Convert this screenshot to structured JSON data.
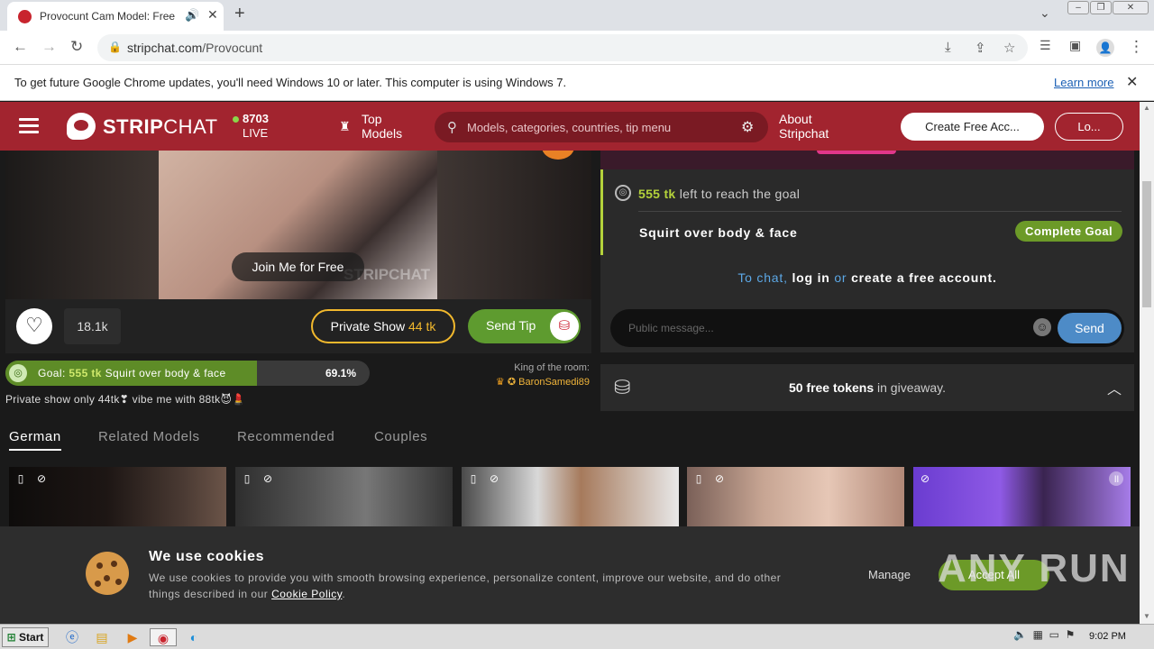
{
  "browser": {
    "tab_title": "Provocunt Cam Model: Free Liv",
    "url_domain": "stripchat.com",
    "url_path": "/Provocunt",
    "update_message": "To get future Google Chrome updates, you'll need Windows 10 or later. This computer is using Windows 7.",
    "update_link": "Learn more"
  },
  "header": {
    "logo_bold": "STRIP",
    "logo_light": "CHAT",
    "live_count": "8703",
    "live_label": "LIVE",
    "top_models": "Top Models",
    "search_placeholder": "Models, categories, countries, tip menu",
    "about": "About Stripchat",
    "create_account": "Create Free Acc...",
    "login": "Lo..."
  },
  "player": {
    "join_label": "Join Me for Free",
    "watermark": "STRIPCHAT",
    "fav_count": "18.1k",
    "private_label": "Private Show",
    "private_price": "44 tk",
    "tip_label": "Send Tip"
  },
  "goal": {
    "prefix": "Goal:",
    "tokens": "555 tk",
    "description": "Squirt over body & face",
    "percent": "69.1%",
    "progress": 0.691
  },
  "king": {
    "label": "King of the room:",
    "name": "BaronSamedi89"
  },
  "subject": "Private show only 44tk❣ vibe me with 88tk😈💄",
  "goal_card": {
    "tokens": "555 tk",
    "suffix": "left to reach the goal",
    "name": "Squirt over body & face",
    "badge": "Complete Goal"
  },
  "chat": {
    "to_chat": "To chat,",
    "log_in": "log in",
    "or": "or",
    "create": "create a free account.",
    "placeholder": "Public message...",
    "send": "Send"
  },
  "giveaway": {
    "bold": "50 free tokens",
    "rest": "in giveaway."
  },
  "category_tabs": [
    "German",
    "Related Models",
    "Recommended",
    "Couples"
  ],
  "cookie": {
    "title": "We use cookies",
    "body": "We use cookies to provide you with smooth browsing experience, personalize content, improve our website, and do other things described in our",
    "link": "Cookie Policy",
    "body_end": ".",
    "manage": "Manage",
    "accept": "Accept All"
  },
  "watermark_overlay": "ANY RUN",
  "taskbar": {
    "start": "Start",
    "clock": "9:02 PM"
  },
  "colors": {
    "brand_red": "#a2242f",
    "goal_green": "#6c9a28",
    "gold": "#f1b82d",
    "link_blue": "#5ca8e6"
  }
}
